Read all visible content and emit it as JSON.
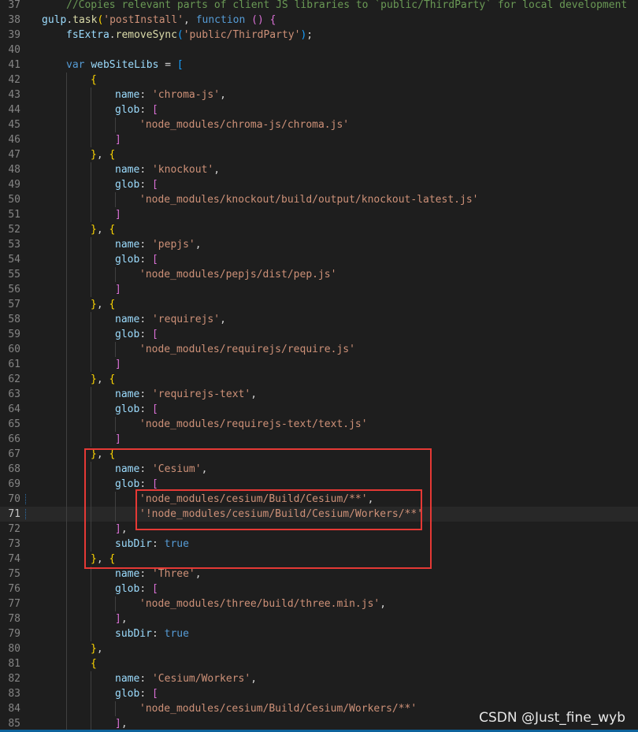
{
  "editor": {
    "lines": [
      {
        "num": "37",
        "indent": 1,
        "tokens": [
          [
            "c",
            "//Copies relevant parts of client JS libraries to `public/ThirdParty` for local development"
          ]
        ]
      },
      {
        "num": "38",
        "indent": 0,
        "tokens": [
          [
            "v",
            "gulp"
          ],
          [
            "p",
            "."
          ],
          [
            "f",
            "task"
          ],
          [
            "b1",
            "("
          ],
          [
            "s",
            "'postInstall'"
          ],
          [
            "p",
            ", "
          ],
          [
            "k",
            "function"
          ],
          [
            "p",
            " "
          ],
          [
            "b2",
            "()"
          ],
          [
            "p",
            " "
          ],
          [
            "b2",
            "{"
          ]
        ]
      },
      {
        "num": "39",
        "indent": 1,
        "tokens": [
          [
            "v",
            "fsExtra"
          ],
          [
            "p",
            "."
          ],
          [
            "f",
            "removeSync"
          ],
          [
            "b3",
            "("
          ],
          [
            "s",
            "'public/ThirdParty'"
          ],
          [
            "b3",
            ")"
          ],
          [
            "p",
            ";"
          ]
        ]
      },
      {
        "num": "40",
        "indent": 1,
        "tokens": []
      },
      {
        "num": "41",
        "indent": 1,
        "tokens": [
          [
            "k",
            "var"
          ],
          [
            "p",
            " "
          ],
          [
            "v",
            "webSiteLibs"
          ],
          [
            "p",
            " = "
          ],
          [
            "b3",
            "["
          ]
        ]
      },
      {
        "num": "42",
        "indent": 2,
        "tokens": [
          [
            "b1",
            "{"
          ]
        ]
      },
      {
        "num": "43",
        "indent": 3,
        "tokens": [
          [
            "v",
            "name"
          ],
          [
            "p",
            ": "
          ],
          [
            "s",
            "'chroma-js'"
          ],
          [
            "p",
            ","
          ]
        ]
      },
      {
        "num": "44",
        "indent": 3,
        "tokens": [
          [
            "v",
            "glob"
          ],
          [
            "p",
            ": "
          ],
          [
            "b2",
            "["
          ]
        ]
      },
      {
        "num": "45",
        "indent": 4,
        "tokens": [
          [
            "s",
            "'node_modules/chroma-js/chroma.js'"
          ]
        ]
      },
      {
        "num": "46",
        "indent": 3,
        "tokens": [
          [
            "b2",
            "]"
          ]
        ]
      },
      {
        "num": "47",
        "indent": 2,
        "tokens": [
          [
            "b1",
            "}"
          ],
          [
            "p",
            ", "
          ],
          [
            "b1",
            "{"
          ]
        ]
      },
      {
        "num": "48",
        "indent": 3,
        "tokens": [
          [
            "v",
            "name"
          ],
          [
            "p",
            ": "
          ],
          [
            "s",
            "'knockout'"
          ],
          [
            "p",
            ","
          ]
        ]
      },
      {
        "num": "49",
        "indent": 3,
        "tokens": [
          [
            "v",
            "glob"
          ],
          [
            "p",
            ": "
          ],
          [
            "b2",
            "["
          ]
        ]
      },
      {
        "num": "50",
        "indent": 4,
        "tokens": [
          [
            "s",
            "'node_modules/knockout/build/output/knockout-latest.js'"
          ]
        ]
      },
      {
        "num": "51",
        "indent": 3,
        "tokens": [
          [
            "b2",
            "]"
          ]
        ]
      },
      {
        "num": "52",
        "indent": 2,
        "tokens": [
          [
            "b1",
            "}"
          ],
          [
            "p",
            ", "
          ],
          [
            "b1",
            "{"
          ]
        ]
      },
      {
        "num": "53",
        "indent": 3,
        "tokens": [
          [
            "v",
            "name"
          ],
          [
            "p",
            ": "
          ],
          [
            "s",
            "'pepjs'"
          ],
          [
            "p",
            ","
          ]
        ]
      },
      {
        "num": "54",
        "indent": 3,
        "tokens": [
          [
            "v",
            "glob"
          ],
          [
            "p",
            ": "
          ],
          [
            "b2",
            "["
          ]
        ]
      },
      {
        "num": "55",
        "indent": 4,
        "tokens": [
          [
            "s",
            "'node_modules/pepjs/dist/pep.js'"
          ]
        ]
      },
      {
        "num": "56",
        "indent": 3,
        "tokens": [
          [
            "b2",
            "]"
          ]
        ]
      },
      {
        "num": "57",
        "indent": 2,
        "tokens": [
          [
            "b1",
            "}"
          ],
          [
            "p",
            ", "
          ],
          [
            "b1",
            "{"
          ]
        ]
      },
      {
        "num": "58",
        "indent": 3,
        "tokens": [
          [
            "v",
            "name"
          ],
          [
            "p",
            ": "
          ],
          [
            "s",
            "'requirejs'"
          ],
          [
            "p",
            ","
          ]
        ]
      },
      {
        "num": "59",
        "indent": 3,
        "tokens": [
          [
            "v",
            "glob"
          ],
          [
            "p",
            ": "
          ],
          [
            "b2",
            "["
          ]
        ]
      },
      {
        "num": "60",
        "indent": 4,
        "tokens": [
          [
            "s",
            "'node_modules/requirejs/require.js'"
          ]
        ]
      },
      {
        "num": "61",
        "indent": 3,
        "tokens": [
          [
            "b2",
            "]"
          ]
        ]
      },
      {
        "num": "62",
        "indent": 2,
        "tokens": [
          [
            "b1",
            "}"
          ],
          [
            "p",
            ", "
          ],
          [
            "b1",
            "{"
          ]
        ]
      },
      {
        "num": "63",
        "indent": 3,
        "tokens": [
          [
            "v",
            "name"
          ],
          [
            "p",
            ": "
          ],
          [
            "s",
            "'requirejs-text'"
          ],
          [
            "p",
            ","
          ]
        ]
      },
      {
        "num": "64",
        "indent": 3,
        "tokens": [
          [
            "v",
            "glob"
          ],
          [
            "p",
            ": "
          ],
          [
            "b2",
            "["
          ]
        ]
      },
      {
        "num": "65",
        "indent": 4,
        "tokens": [
          [
            "s",
            "'node_modules/requirejs-text/text.js'"
          ]
        ]
      },
      {
        "num": "66",
        "indent": 3,
        "tokens": [
          [
            "b2",
            "]"
          ]
        ]
      },
      {
        "num": "67",
        "indent": 2,
        "tokens": [
          [
            "b1",
            "}"
          ],
          [
            "p",
            ", "
          ],
          [
            "b1",
            "{"
          ]
        ]
      },
      {
        "num": "68",
        "indent": 3,
        "tokens": [
          [
            "v",
            "name"
          ],
          [
            "p",
            ": "
          ],
          [
            "s",
            "'Cesium'"
          ],
          [
            "p",
            ","
          ]
        ]
      },
      {
        "num": "69",
        "indent": 3,
        "tokens": [
          [
            "v",
            "glob"
          ],
          [
            "p",
            ": "
          ],
          [
            "b2",
            "["
          ]
        ]
      },
      {
        "num": "70",
        "indent": 4,
        "modified": true,
        "tokens": [
          [
            "s",
            "'node_modules/cesium/Build/Cesium/**'"
          ],
          [
            "p",
            ","
          ]
        ]
      },
      {
        "num": "71",
        "indent": 4,
        "current": true,
        "modified": true,
        "tokens": [
          [
            "s",
            "'!node_modules/cesium/Build/Cesium/Workers/**'"
          ]
        ]
      },
      {
        "num": "72",
        "indent": 3,
        "tokens": [
          [
            "b2",
            "]"
          ],
          [
            "p",
            ","
          ]
        ]
      },
      {
        "num": "73",
        "indent": 3,
        "tokens": [
          [
            "v",
            "subDir"
          ],
          [
            "p",
            ": "
          ],
          [
            "k",
            "true"
          ]
        ]
      },
      {
        "num": "74",
        "indent": 2,
        "tokens": [
          [
            "b1",
            "}"
          ],
          [
            "p",
            ", "
          ],
          [
            "b1",
            "{"
          ]
        ]
      },
      {
        "num": "75",
        "indent": 3,
        "tokens": [
          [
            "v",
            "name"
          ],
          [
            "p",
            ": "
          ],
          [
            "s",
            "'Three'"
          ],
          [
            "p",
            ","
          ]
        ]
      },
      {
        "num": "76",
        "indent": 3,
        "tokens": [
          [
            "v",
            "glob"
          ],
          [
            "p",
            ": "
          ],
          [
            "b2",
            "["
          ]
        ]
      },
      {
        "num": "77",
        "indent": 4,
        "tokens": [
          [
            "s",
            "'node_modules/three/build/three.min.js'"
          ],
          [
            "p",
            ","
          ]
        ]
      },
      {
        "num": "78",
        "indent": 3,
        "tokens": [
          [
            "b2",
            "]"
          ],
          [
            "p",
            ","
          ]
        ]
      },
      {
        "num": "79",
        "indent": 3,
        "tokens": [
          [
            "v",
            "subDir"
          ],
          [
            "p",
            ": "
          ],
          [
            "k",
            "true"
          ]
        ]
      },
      {
        "num": "80",
        "indent": 2,
        "tokens": [
          [
            "b1",
            "}"
          ],
          [
            "p",
            ","
          ]
        ]
      },
      {
        "num": "81",
        "indent": 2,
        "tokens": [
          [
            "b1",
            "{"
          ]
        ]
      },
      {
        "num": "82",
        "indent": 3,
        "tokens": [
          [
            "v",
            "name"
          ],
          [
            "p",
            ": "
          ],
          [
            "s",
            "'Cesium/Workers'"
          ],
          [
            "p",
            ","
          ]
        ]
      },
      {
        "num": "83",
        "indent": 3,
        "tokens": [
          [
            "v",
            "glob"
          ],
          [
            "p",
            ": "
          ],
          [
            "b2",
            "["
          ]
        ]
      },
      {
        "num": "84",
        "indent": 4,
        "tokens": [
          [
            "s",
            "'node_modules/cesium/Build/Cesium/Workers/**'"
          ]
        ]
      },
      {
        "num": "85",
        "indent": 3,
        "tokens": [
          [
            "b2",
            "]"
          ],
          [
            "p",
            ","
          ]
        ]
      }
    ]
  },
  "watermark": "CSDN @Just_fine_wyb",
  "annotation_color": "#e53935"
}
